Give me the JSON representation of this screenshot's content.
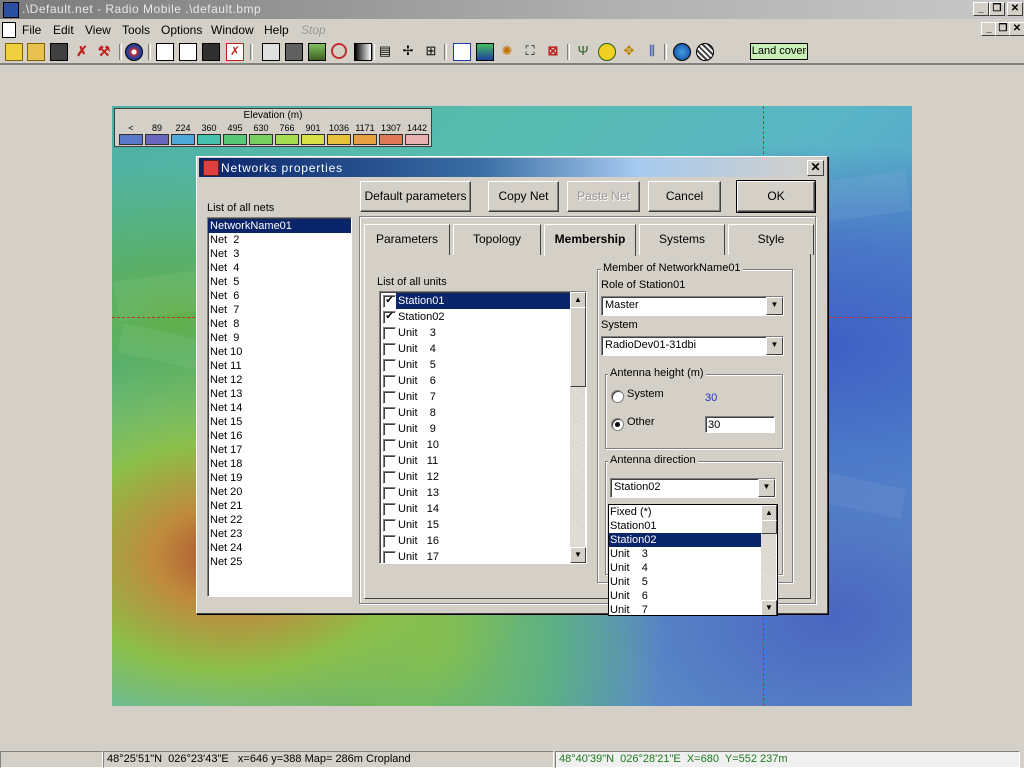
{
  "window": {
    "title": ".\\Default.net - Radio Mobile .\\default.bmp"
  },
  "menu": [
    {
      "label": "File"
    },
    {
      "label": "Edit"
    },
    {
      "label": "View"
    },
    {
      "label": "Tools"
    },
    {
      "label": "Options"
    },
    {
      "label": "Window"
    },
    {
      "label": "Help"
    },
    {
      "label": "Stop"
    }
  ],
  "toolbar": {
    "land_cover_label": "Land cover"
  },
  "legend": {
    "title": "Elevation (m)",
    "labels": [
      "<",
      "89",
      "224",
      "360",
      "495",
      "630",
      "766",
      "901",
      "1036",
      "1171",
      "1307",
      "1442"
    ],
    "colors": [
      "#5a78c8",
      "#6a66c0",
      "#4ea8d8",
      "#48c0b0",
      "#58c878",
      "#78d060",
      "#a8dc50",
      "#d8e048",
      "#e8c040",
      "#e8a040",
      "#e07858",
      "#e8b0b0"
    ]
  },
  "dialog": {
    "title": "Networks properties",
    "close_label": "✕",
    "buttons": {
      "default_parameters": "Default parameters",
      "copy_net": "Copy Net",
      "paste_net": "Paste Net",
      "cancel": "Cancel",
      "ok": "OK"
    },
    "nets_label": "List of all nets",
    "nets": [
      "NetworkName01",
      "Net  2",
      "Net  3",
      "Net  4",
      "Net  5",
      "Net  6",
      "Net  7",
      "Net  8",
      "Net  9",
      "Net 10",
      "Net 11",
      "Net 12",
      "Net 13",
      "Net 14",
      "Net 15",
      "Net 16",
      "Net 17",
      "Net 18",
      "Net 19",
      "Net 20",
      "Net 21",
      "Net 22",
      "Net 23",
      "Net 24",
      "Net 25"
    ],
    "tabs": [
      {
        "label": "Parameters"
      },
      {
        "label": "Topology"
      },
      {
        "label": "Membership"
      },
      {
        "label": "Systems"
      },
      {
        "label": "Style"
      }
    ],
    "units_label": "List of all units",
    "units": [
      {
        "label": "Station01",
        "checked": true
      },
      {
        "label": "Station02",
        "checked": true
      },
      {
        "label": "Unit    3",
        "checked": false
      },
      {
        "label": "Unit    4",
        "checked": false
      },
      {
        "label": "Unit    5",
        "checked": false
      },
      {
        "label": "Unit    6",
        "checked": false
      },
      {
        "label": "Unit    7",
        "checked": false
      },
      {
        "label": "Unit    8",
        "checked": false
      },
      {
        "label": "Unit    9",
        "checked": false
      },
      {
        "label": "Unit   10",
        "checked": false
      },
      {
        "label": "Unit   11",
        "checked": false
      },
      {
        "label": "Unit   12",
        "checked": false
      },
      {
        "label": "Unit   13",
        "checked": false
      },
      {
        "label": "Unit   14",
        "checked": false
      },
      {
        "label": "Unit   15",
        "checked": false
      },
      {
        "label": "Unit   16",
        "checked": false
      },
      {
        "label": "Unit   17",
        "checked": false
      }
    ],
    "member": {
      "group_label": "Member of NetworkName01",
      "role_label": "Role of Station01",
      "role_value": "Master",
      "system_label": "System",
      "system_value": "RadioDev01-31dbi",
      "antenna_height_label": "Antenna height (m)",
      "system_radio_label": "System",
      "system_height_value": "30",
      "other_radio_label": "Other",
      "other_height_value": "30",
      "antenna_direction_label": "Antenna direction",
      "direction_value": "Station02",
      "direction_options": [
        "Fixed (*)",
        "Station01",
        "Station02",
        "Unit    3",
        "Unit    4",
        "Unit    5",
        "Unit    6",
        "Unit    7"
      ]
    }
  },
  "status": {
    "left": "48°25'51\"N  026°23'43\"E   x=646 y=388 Map= 286m Cropland",
    "right": "48°40'39\"N  026°28'21\"E  X=680  Y=552 237m"
  }
}
